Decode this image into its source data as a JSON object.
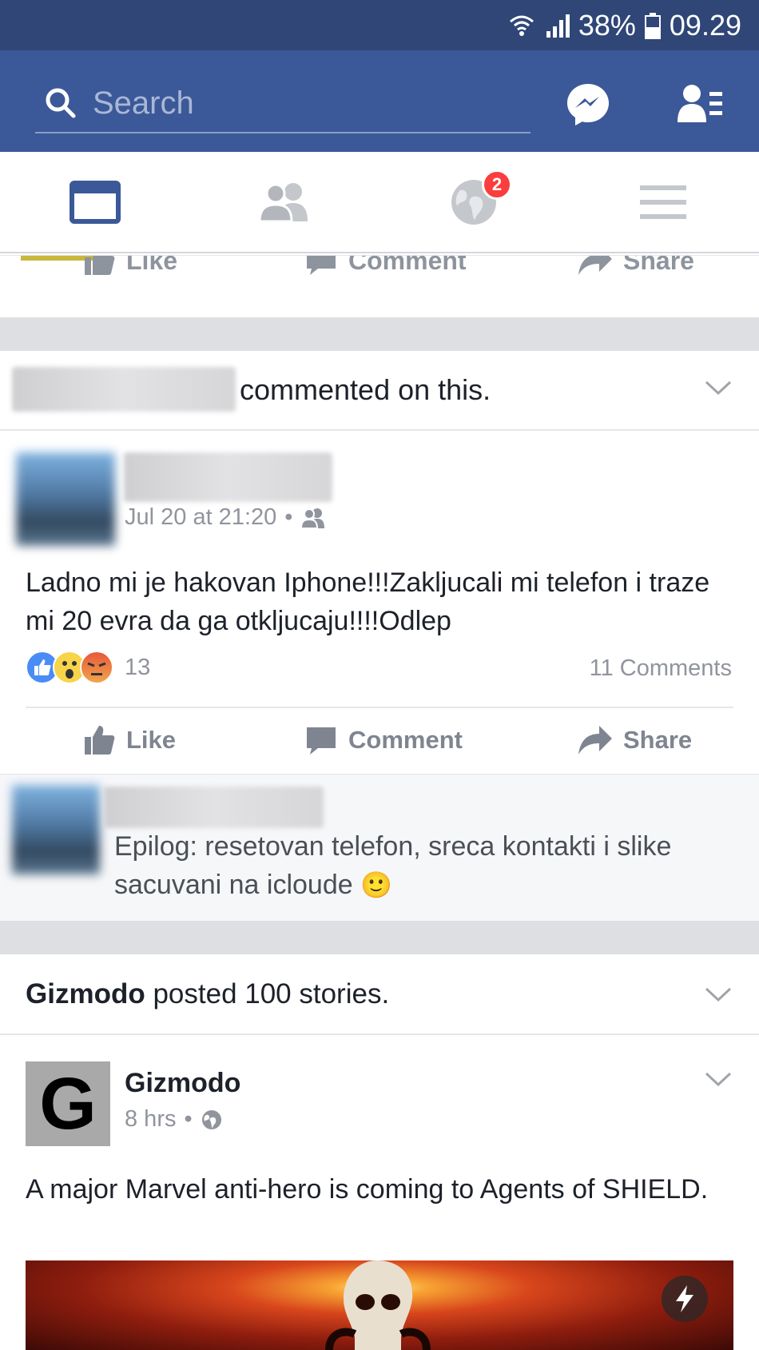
{
  "status_bar": {
    "battery": "38%",
    "time": "09.29"
  },
  "header": {
    "search": {
      "placeholder": "Search"
    },
    "messenger_icon": "messenger-icon",
    "friend_requests_icon": "friend-requests-icon"
  },
  "tabs": [
    {
      "name": "news-feed",
      "icon": "newsfeed-icon",
      "active": true
    },
    {
      "name": "friends",
      "icon": "friends-icon",
      "active": false
    },
    {
      "name": "notifications",
      "icon": "globe-icon",
      "active": false,
      "badge": "2"
    },
    {
      "name": "menu",
      "icon": "hamburger-icon",
      "active": false
    }
  ],
  "prev_card": {
    "actions": {
      "like": "Like",
      "comment": "Comment",
      "share": "Share"
    }
  },
  "story1": {
    "header_text": "commented on this.",
    "post": {
      "timestamp": "Jul 20 at 21:20",
      "separator": "•",
      "privacy_icon": "friends-privacy-icon",
      "text": "Ladno mi je hakovan Iphone!!!Zakljucali mi telefon i traze mi 20 evra da ga otkljucaju!!!!Odlep",
      "reactions": [
        "like",
        "wow",
        "angry"
      ],
      "reaction_count": "13",
      "comments_count": "11 Comments"
    },
    "actions": {
      "like": "Like",
      "comment": "Comment",
      "share": "Share"
    },
    "comment": {
      "text": "Epilog: resetovan telefon, sreca kontakti i slike sacuvani na icloude",
      "emoji": "🙂"
    }
  },
  "story2": {
    "page_name": "Gizmodo",
    "header_suffix": " posted 100 stories.",
    "post": {
      "author": "Gizmodo",
      "logo_letter": "G",
      "timestamp": "8 hrs",
      "separator": "•",
      "privacy_icon": "globe-privacy-icon",
      "text": "A major Marvel anti-hero is coming to Agents of SHIELD."
    },
    "instant_article_icon": "lightning-icon"
  },
  "colors": {
    "status_bar": "#2f4677",
    "header": "#3b5998",
    "active_tab": "#3b5998",
    "badge": "#fa3e3e",
    "muted_text": "#90949c",
    "separator": "#dddfe2"
  }
}
